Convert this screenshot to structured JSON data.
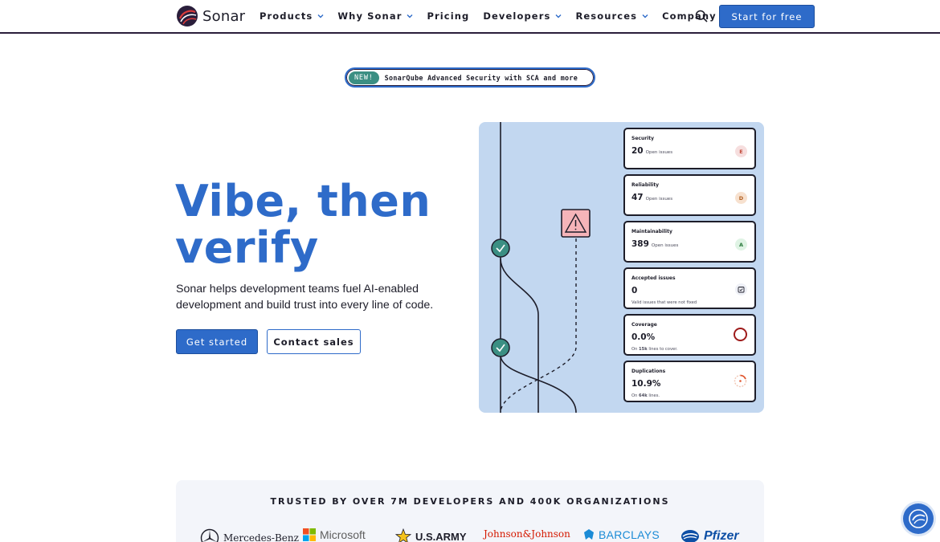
{
  "brand": {
    "name": "Sonar",
    "accent": "#2e6bc9",
    "logo_icon": "sonar-logo-icon"
  },
  "nav": {
    "items": [
      {
        "label": "Products",
        "has_dropdown": true
      },
      {
        "label": "Why Sonar",
        "has_dropdown": true
      },
      {
        "label": "Pricing",
        "has_dropdown": false
      },
      {
        "label": "Developers",
        "has_dropdown": true
      },
      {
        "label": "Resources",
        "has_dropdown": true
      },
      {
        "label": "Company",
        "has_dropdown": true
      }
    ],
    "search_icon": "search-icon",
    "cta": "Start for free"
  },
  "banner": {
    "badge": "NEW!",
    "text": "SonarQube Advanced Security with SCA and more"
  },
  "hero": {
    "title_line1": "Vibe, then",
    "title_line2": "verify",
    "subtitle": "Sonar helps development teams fuel AI-enabled development and build trust into every line of code.",
    "primary_cta": "Get started",
    "secondary_cta": "Contact sales"
  },
  "metrics": [
    {
      "title": "Security",
      "value": "20",
      "label": "Open issues",
      "grade": "E",
      "grade_color": "#c24a3a",
      "grade_bg": "#f6dede"
    },
    {
      "title": "Reliability",
      "value": "47",
      "label": "Open issues",
      "grade": "D",
      "grade_color": "#b25e1e",
      "grade_bg": "#f7e1cf"
    },
    {
      "title": "Maintainability",
      "value": "389",
      "label": "Open issues",
      "grade": "A",
      "grade_color": "#2a7a3c",
      "grade_bg": "#dff3e4"
    },
    {
      "title": "Accepted issues",
      "value": "0",
      "note": "Valid issues that were not fixed"
    },
    {
      "title": "Coverage",
      "value": "0.0%",
      "note_prefix": "On ",
      "note_strong": "15k",
      "note_suffix": " lines to cover."
    },
    {
      "title": "Duplications",
      "value": "10.9%",
      "note_prefix": "On ",
      "note_strong": "64k",
      "note_suffix": " lines."
    }
  ],
  "trust": {
    "title": "TRUSTED BY OVER 7M DEVELOPERS AND 400K ORGANIZATIONS",
    "logos": [
      "Mercedes-Benz",
      "Microsoft",
      "U.S.ARMY",
      "Johnson&Johnson",
      "BARCLAYS",
      "Pfizer"
    ]
  },
  "widget": {
    "icon": "sonar-chat-icon"
  }
}
